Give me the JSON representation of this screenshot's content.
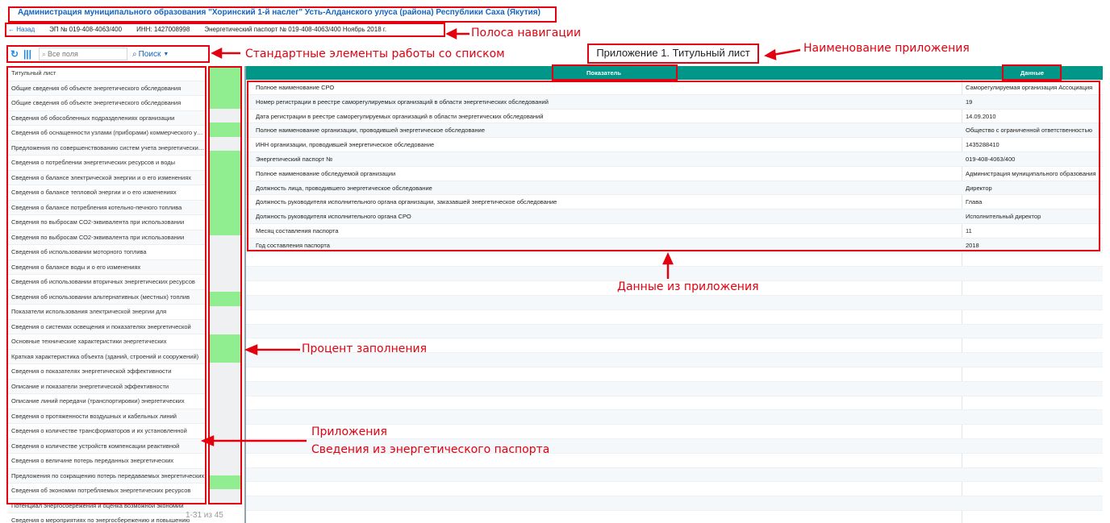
{
  "header": {
    "org_title": "Администрация муниципального образования \"Хоринский 1-й наслег\" Усть-Алданского улуса (района) Республики Саха (Якутия)"
  },
  "nav": {
    "back_label": "← Назад",
    "ep_number": "ЭП № 019-408-4063/400",
    "inn": "ИНН: 1427008998",
    "passport": "Энергетический паспорт № 019-408-4063/400 Ноябрь 2018 г."
  },
  "toolbar": {
    "search_placeholder": "Все поля",
    "search_button": "Поиск"
  },
  "app_title": "Приложение 1. Титульный лист",
  "sidebar": {
    "items": [
      "Титульный лист",
      "Общие сведения об объекте энергетического обследования",
      "Общие сведения об объекте энергетического обследования",
      "Сведения об обособленных подразделениях организации",
      "Сведения об оснащенности узлами (приборами) коммерческого учета",
      "Предложения по совершенствованию систем учета энергетических ресурсов",
      "Сведения о потреблении энергетических ресурсов и воды",
      "Сведения о балансе электрической энергии и о его изменениях",
      "Сведения о балансе тепловой энергии и о его изменениях",
      "Сведения о балансе потребления котельно-печного топлива",
      "Сведения по выбросам СО2-эквивалента при использовании",
      "Сведения по выбросам СО2-эквивалента при использовании",
      "Сведения об использовании моторного топлива",
      "Сведения о балансе воды и о его изменениях",
      "Сведения об использовании вторичных энергетических ресурсов",
      "Сведения об использовании альтернативных (местных) топлив",
      "Показатели использования электрической энергии для",
      "Сведения о системах освещения и показателях энергетической",
      "Основные технические характеристики энергетических",
      "Краткая характеристика объекта (зданий, строений и сооружений)",
      "Сведения о показателях энергетической эффективности",
      "Описание и показатели энергетической эффективности",
      "Описание линий передачи (транспортировки) энергетических",
      "Сведения о протяженности воздушных и кабельных линий",
      "Сведения о количестве трансформаторов и их установленной",
      "Сведения о количестве устройств компенсации реактивной",
      "Сведения о величине потерь переданных энергетических",
      "Предложения по сокращению потерь передаваемых энергетических",
      "Сведения об экономии потребляемых энергетических ресурсов",
      "Потенциал энергосбережения и оценка возможной экономии",
      "Сведения о мероприятиях по энергосбережению и повышению"
    ],
    "fill_percent": [
      100,
      100,
      100,
      0,
      100,
      0,
      100,
      100,
      100,
      100,
      100,
      100,
      0,
      0,
      0,
      0,
      100,
      0,
      0,
      100,
      100,
      0,
      0,
      0,
      0,
      0,
      0,
      0,
      0,
      100,
      0
    ],
    "pager": "1-31 из 45",
    "fill_color": "#90ee90"
  },
  "grid": {
    "col_indicator": "Показатель",
    "col_data": "Данные",
    "header_color": "#009688",
    "rows": [
      {
        "k": "Полное наименование СРО",
        "v": "Саморегулируемая организация Ассоциация"
      },
      {
        "k": "Номер регистрации в реестре саморегулируемых организаций в области энергетических обследований",
        "v": "19"
      },
      {
        "k": "Дата регистрации в реестре саморегулируемых организаций в области энергетических обследований",
        "v": "14.09.2010"
      },
      {
        "k": "Полное наименование организации, проводившей энергетическое обследование",
        "v": "Общество с ограниченной ответственностью"
      },
      {
        "k": "ИНН организации, проводившей энергетическое обследование",
        "v": "1435288410"
      },
      {
        "k": "Энергетический паспорт №",
        "v": "019-408-4063/400"
      },
      {
        "k": "Полное наименование обследуемой организации",
        "v": "Администрация муниципального образования"
      },
      {
        "k": "Должность лица, проводившего энергетическое обследование",
        "v": "Директор"
      },
      {
        "k": "Должность руководителя исполнительного органа организации, заказавшей энергетическое обследование",
        "v": "Глава"
      },
      {
        "k": "Должность руководителя исполнительного органа СРО",
        "v": "Исполнительный директор"
      },
      {
        "k": "Месяц составления паспорта",
        "v": "11"
      },
      {
        "k": "Год составления паспорта",
        "v": "2018"
      }
    ]
  },
  "annotations": {
    "nav_bar": "Полоса навигации",
    "app_name": "Наименование приложения",
    "list_tools": "Стандартные элементы работы со списком",
    "app_data": "Данные из приложения",
    "fill_pct": "Процент заполнения",
    "apps_line1": "Приложения",
    "apps_line2": "Сведения из энергетического паспорта",
    "accent_color": "#e3000f"
  }
}
